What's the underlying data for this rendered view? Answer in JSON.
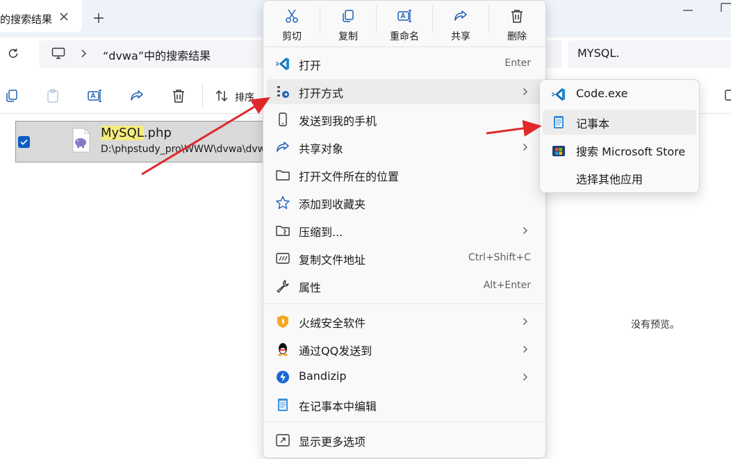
{
  "tab": {
    "title": "的搜索结果",
    "close": "✕",
    "new": "+"
  },
  "address": {
    "path": "“dvwa”中的搜索结果",
    "search_value": "MYSQL."
  },
  "toolbar": {
    "sort_label": "排序"
  },
  "file": {
    "name_highlight": "MySQL",
    "name_rest": ".php",
    "path": "D:\\phpstudy_pro\\WWW\\dvwa\\dvwa\\includes"
  },
  "preview": {
    "empty_text": "没有预览。"
  },
  "context_menu": {
    "quick_actions": [
      {
        "label": "剪切",
        "icon": "scissors-icon"
      },
      {
        "label": "复制",
        "icon": "copy-icon"
      },
      {
        "label": "重命名",
        "icon": "rename-icon"
      },
      {
        "label": "共享",
        "icon": "share-icon"
      },
      {
        "label": "删除",
        "icon": "trash-icon"
      }
    ],
    "items": [
      {
        "label": "打开",
        "shortcut": "Enter",
        "icon": "vscode-icon"
      },
      {
        "label": "打开方式",
        "submenu": true,
        "icon": "open-with-icon"
      },
      {
        "label": "发送到我的手机",
        "icon": "phone-icon"
      },
      {
        "label": "共享对象",
        "submenu": true,
        "icon": "share-icon"
      },
      {
        "label": "打开文件所在的位置",
        "icon": "folder-icon"
      },
      {
        "label": "添加到收藏夹",
        "icon": "star-icon"
      },
      {
        "label": "压缩到...",
        "submenu": true,
        "icon": "zip-folder-icon"
      },
      {
        "label": "复制文件地址",
        "shortcut": "Ctrl+Shift+C",
        "icon": "copy-path-icon"
      },
      {
        "label": "属性",
        "shortcut": "Alt+Enter",
        "icon": "wrench-icon"
      },
      {
        "label": "火绒安全软件",
        "submenu": true,
        "icon": "huorong-icon"
      },
      {
        "label": "通过QQ发送到",
        "submenu": true,
        "icon": "qq-icon"
      },
      {
        "label": "Bandizip",
        "submenu": true,
        "icon": "bandizip-icon"
      },
      {
        "label": "在记事本中编辑",
        "icon": "notepad-icon"
      },
      {
        "label": "显示更多选项",
        "icon": "more-options-icon"
      }
    ]
  },
  "submenu": {
    "items": [
      {
        "label": "Code.exe",
        "icon": "vscode-icon"
      },
      {
        "label": "记事本",
        "icon": "notepad-icon"
      },
      {
        "label": "搜索 Microsoft Store",
        "icon": "ms-store-icon"
      },
      {
        "label": "选择其他应用",
        "icon": ""
      }
    ]
  },
  "colors": {
    "accent": "#0a5ec4",
    "annotation_arrow": "#e0272b",
    "highlight": "#f4ec7e"
  }
}
